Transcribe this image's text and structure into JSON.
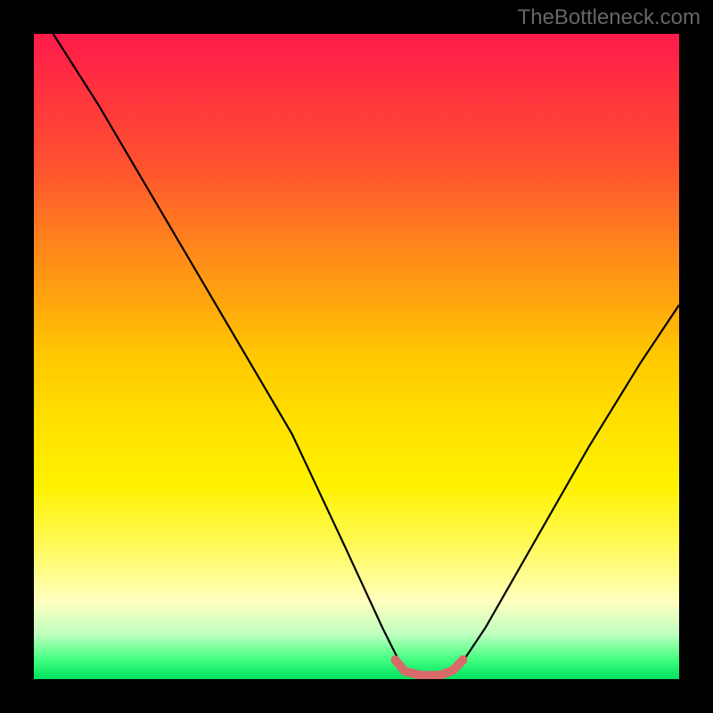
{
  "watermark": "TheBottleneck.com",
  "chart_data": {
    "type": "line",
    "title": "",
    "xlabel": "",
    "ylabel": "",
    "x_range": [
      0,
      100
    ],
    "y_range": [
      0,
      100
    ],
    "curve_left": {
      "comment": "Steep descending black curve from upper-left toward valley",
      "points": [
        [
          3,
          100
        ],
        [
          10,
          89
        ],
        [
          20,
          72
        ],
        [
          30,
          55
        ],
        [
          40,
          38
        ],
        [
          48,
          21
        ],
        [
          54,
          8
        ],
        [
          57,
          2
        ]
      ]
    },
    "curve_right": {
      "comment": "Ascending black curve from valley toward upper-right",
      "points": [
        [
          66,
          2
        ],
        [
          70,
          8
        ],
        [
          78,
          22
        ],
        [
          86,
          36
        ],
        [
          94,
          49
        ],
        [
          100,
          58
        ]
      ]
    },
    "valley_highlight": {
      "comment": "Short salmon/pink segment marking the minimum at the valley floor",
      "points": [
        [
          56,
          3
        ],
        [
          57.5,
          1.2
        ],
        [
          60,
          0.6
        ],
        [
          63,
          0.6
        ],
        [
          65,
          1.4
        ],
        [
          66.5,
          3
        ]
      ],
      "color": "#d86a6a"
    },
    "background_gradient": {
      "top": "#ff1a4a",
      "mid": "#ffe000",
      "bottom": "#00e060"
    }
  }
}
